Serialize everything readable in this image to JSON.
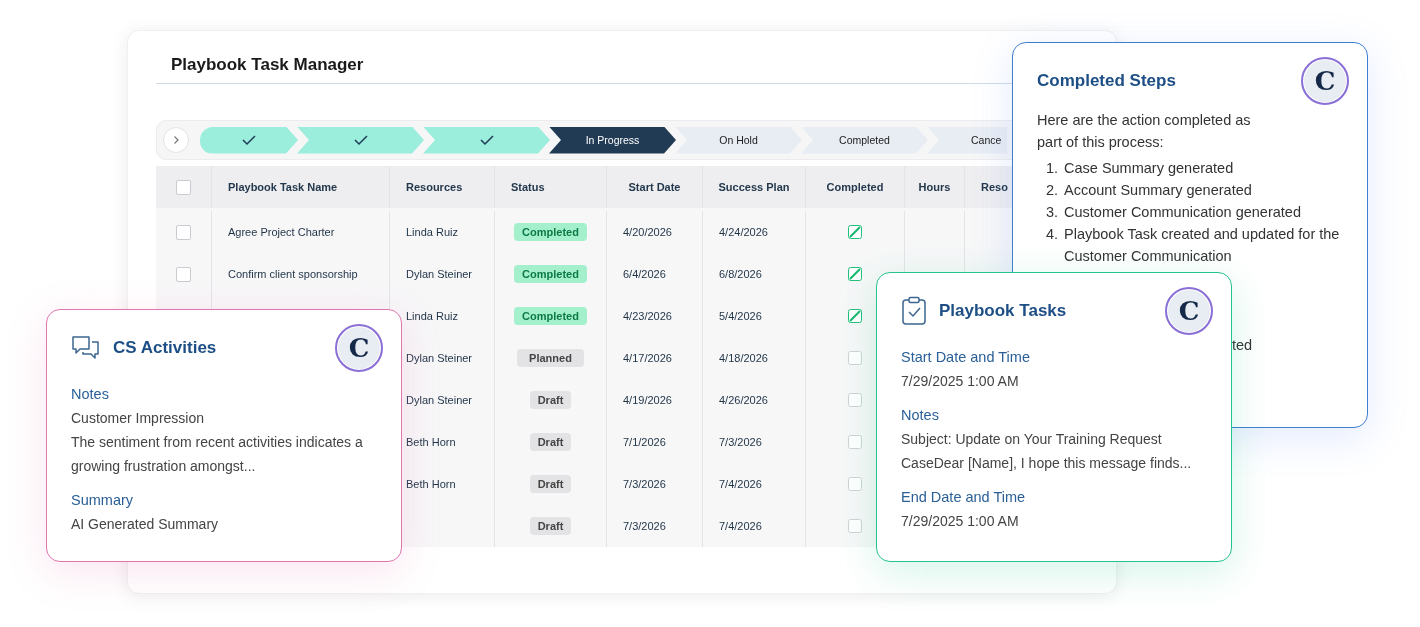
{
  "manager": {
    "title": "Playbook Task Manager",
    "stepper": {
      "steps": [
        {
          "done": true,
          "current": false
        },
        {
          "done": true,
          "current": false
        },
        {
          "done": true,
          "current": false
        },
        {
          "done": false,
          "current": true,
          "label": "In Progress"
        },
        {
          "done": false,
          "current": false,
          "label": "On Hold"
        },
        {
          "done": false,
          "current": false,
          "label": "Completed"
        },
        {
          "done": false,
          "current": false,
          "label": "Cance"
        }
      ]
    },
    "table": {
      "select_all": {
        "checked": false
      },
      "columns": [
        "Playbook Task Name",
        "Resources",
        "Status",
        "Start Date",
        "Success Plan",
        "Completed",
        "Hours",
        "Reso"
      ],
      "rows": [
        {
          "checked": false,
          "name": "Agree Project Charter",
          "resource": "Linda Ruiz",
          "status": {
            "label": "Completed",
            "kind": "completed"
          },
          "start": "4/20/2026",
          "success": "4/24/2026",
          "completed": true
        },
        {
          "checked": false,
          "name": "Confirm client sponsorship",
          "resource": "Dylan Steiner",
          "status": {
            "label": "Completed",
            "kind": "completed"
          },
          "start": "6/4/2026",
          "success": "6/8/2026",
          "completed": true
        },
        {
          "resource": "Linda Ruiz",
          "status": {
            "label": "Completed",
            "kind": "completed"
          },
          "start": "4/23/2026",
          "success": "5/4/2026",
          "completed": true
        },
        {
          "resource": "Dylan Steiner",
          "status": {
            "label": "Planned",
            "kind": "planned"
          },
          "start": "4/17/2026",
          "success": "4/18/2026",
          "completed": false
        },
        {
          "resource": "Dylan Steiner",
          "status": {
            "label": "Draft",
            "kind": "draft"
          },
          "start": "4/19/2026",
          "success": "4/26/2026",
          "completed": false
        },
        {
          "resource": "Beth Horn",
          "status": {
            "label": "Draft",
            "kind": "draft"
          },
          "start": "7/1/2026",
          "success": "7/3/2026",
          "completed": false
        },
        {
          "resource": "Beth Horn",
          "status": {
            "label": "Draft",
            "kind": "draft"
          },
          "start": "7/3/2026",
          "success": "7/4/2026",
          "completed": false
        },
        {
          "status": {
            "label": "Draft",
            "kind": "draft"
          },
          "start": "7/3/2026",
          "success": "7/4/2026",
          "completed": false
        }
      ]
    }
  },
  "completed_steps": {
    "title": "Completed Steps",
    "logo": "C",
    "intro": "Here are the action completed as part of this process:",
    "steps": [
      {
        "number": "1.",
        "text": "Case Summary generated"
      },
      {
        "number": "2.",
        "text": "Account Summary generated"
      },
      {
        "number": "3.",
        "text": "Customer Communication generated"
      },
      {
        "number": "4.",
        "text": "Playbook Task created and updated for the Customer Communication"
      }
    ],
    "fragment": "ted"
  },
  "cs_activities": {
    "title": "CS Activities",
    "logo": "C",
    "sections": [
      {
        "label": "Notes",
        "lines": [
          "Customer Impression",
          "The sentiment from recent activities indicates a growing frustration amongst..."
        ]
      },
      {
        "label": "Summary",
        "lines": [
          "AI Generated Summary"
        ]
      }
    ]
  },
  "playbook_tasks": {
    "title": "Playbook Tasks",
    "logo": "C",
    "sections": [
      {
        "label": "Start Date and Time",
        "lines": [
          "7/29/2025 1:00 AM"
        ]
      },
      {
        "label": "Notes",
        "lines": [
          "Subject: Update on Your Training Request",
          "CaseDear [Name], I hope this message finds..."
        ]
      },
      {
        "label": "End Date and Time",
        "lines": [
          "7/29/2025 1:00 AM"
        ]
      }
    ]
  }
}
